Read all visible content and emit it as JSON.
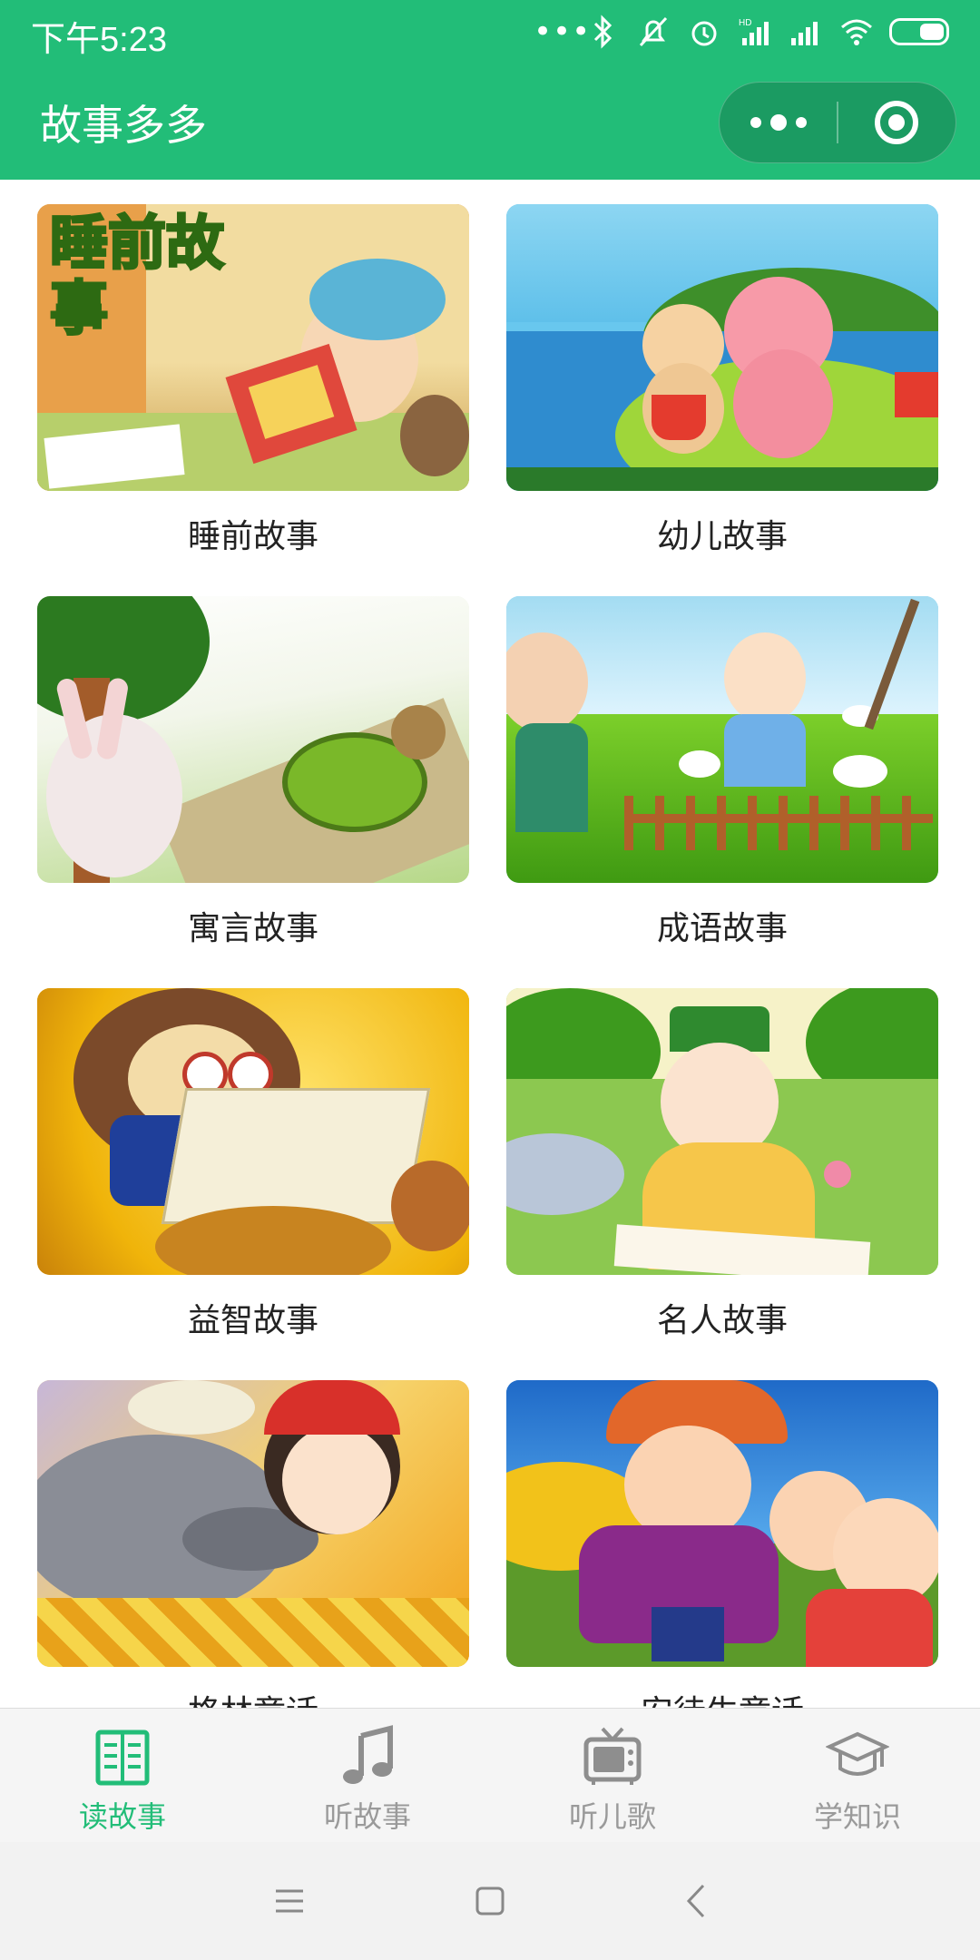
{
  "status_bar": {
    "time": "下午5:23"
  },
  "app_bar": {
    "title": "故事多多"
  },
  "colors": {
    "brand_green": "#22bd78",
    "tab_inactive": "#9a9a9a"
  },
  "categories": [
    {
      "label": "睡前故事",
      "cover_text": "睡前故事"
    },
    {
      "label": "幼儿故事"
    },
    {
      "label": "寓言故事"
    },
    {
      "label": "成语故事"
    },
    {
      "label": "益智故事"
    },
    {
      "label": "名人故事"
    },
    {
      "label": "格林童话"
    },
    {
      "label": "安徒生童话"
    }
  ],
  "tabs": [
    {
      "label": "读故事",
      "icon": "book-icon",
      "active": true
    },
    {
      "label": "听故事",
      "icon": "music-note-icon",
      "active": false
    },
    {
      "label": "听儿歌",
      "icon": "tv-icon",
      "active": false
    },
    {
      "label": "学知识",
      "icon": "graduation-cap-icon",
      "active": false
    }
  ],
  "system_nav": [
    "menu-icon",
    "home-icon",
    "back-icon"
  ]
}
